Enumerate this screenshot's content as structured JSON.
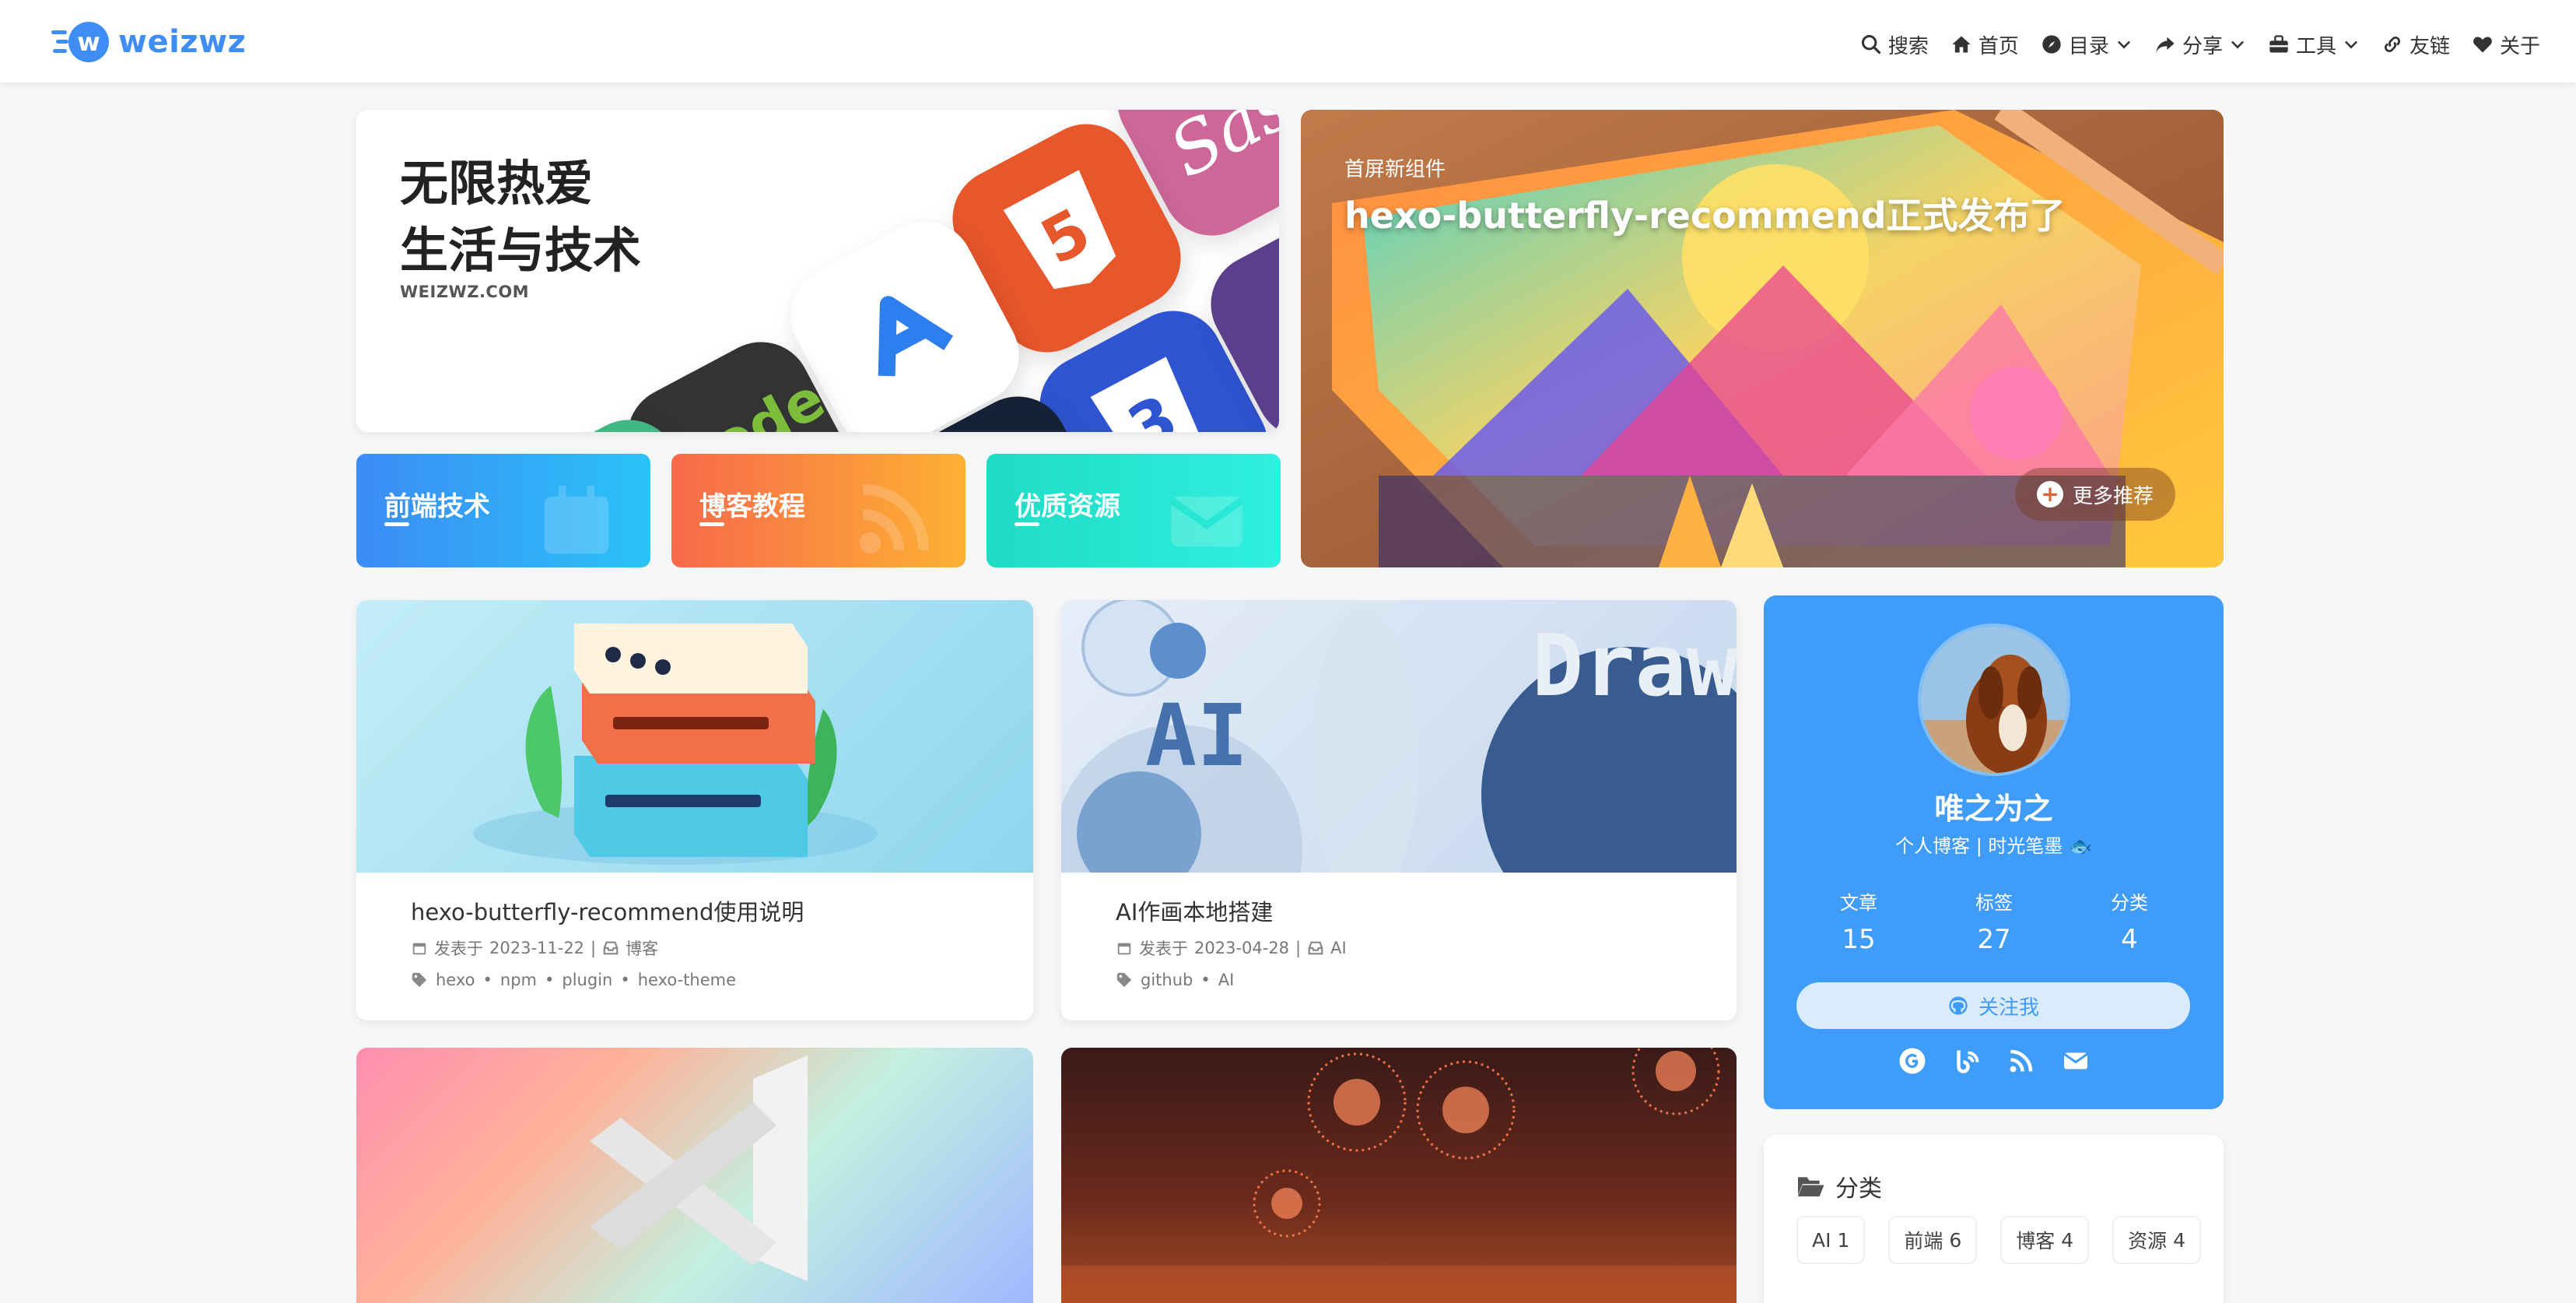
{
  "nav": {
    "logo_text": "weizwz",
    "menu": [
      {
        "label": "搜索",
        "icon": "search-icon",
        "dropdown": false
      },
      {
        "label": "首页",
        "icon": "home-icon",
        "dropdown": false
      },
      {
        "label": "目录",
        "icon": "compass-icon",
        "dropdown": true
      },
      {
        "label": "分享",
        "icon": "share-icon",
        "dropdown": true
      },
      {
        "label": "工具",
        "icon": "toolbox-icon",
        "dropdown": true
      },
      {
        "label": "友链",
        "icon": "link-icon",
        "dropdown": false
      },
      {
        "label": "关于",
        "icon": "heart-icon",
        "dropdown": false
      }
    ]
  },
  "hero": {
    "title_line1": "无限热爱",
    "title_line2": "生活与技术",
    "subtitle": "WEIZWZ.COM"
  },
  "categories": [
    {
      "label": "前端技术",
      "color": "#3b8cf5"
    },
    {
      "label": "博客教程",
      "color": "#f8694b"
    },
    {
      "label": "优质资源",
      "color": "#1fdcc4"
    }
  ],
  "featured": {
    "tag": "首屏新组件",
    "title": "hexo-butterfly-recommend正式发布了",
    "more_label": "更多推荐"
  },
  "posts": [
    {
      "title": "hexo-butterfly-recommend使用说明",
      "date_prefix": "发表于",
      "date": "2023-11-22",
      "category": "博客",
      "tags": [
        "hexo",
        "npm",
        "plugin",
        "hexo-theme"
      ]
    },
    {
      "title": "AI作画本地搭建",
      "date_prefix": "发表于",
      "date": "2023-04-28",
      "category": "AI",
      "tags": [
        "github",
        "AI"
      ],
      "cover_text_ai": "AI",
      "cover_text_draw": "Draw"
    }
  ],
  "profile": {
    "name": "唯之为之",
    "desc": "个人博客 | 时光笔墨 🐟",
    "stats": [
      {
        "label": "文章",
        "value": "15"
      },
      {
        "label": "标签",
        "value": "27"
      },
      {
        "label": "分类",
        "value": "4"
      }
    ],
    "follow_label": "关注我",
    "socials": [
      "google-icon",
      "blog-icon",
      "rss-icon",
      "email-icon"
    ]
  },
  "category_box": {
    "title": "分类",
    "items": [
      {
        "name": "AI",
        "count": "1"
      },
      {
        "name": "前端",
        "count": "6"
      },
      {
        "name": "博客",
        "count": "4"
      },
      {
        "name": "资源",
        "count": "4"
      }
    ]
  },
  "colors": {
    "brand": "#3f8ef5",
    "profile_bg": "#3f9cf8"
  }
}
